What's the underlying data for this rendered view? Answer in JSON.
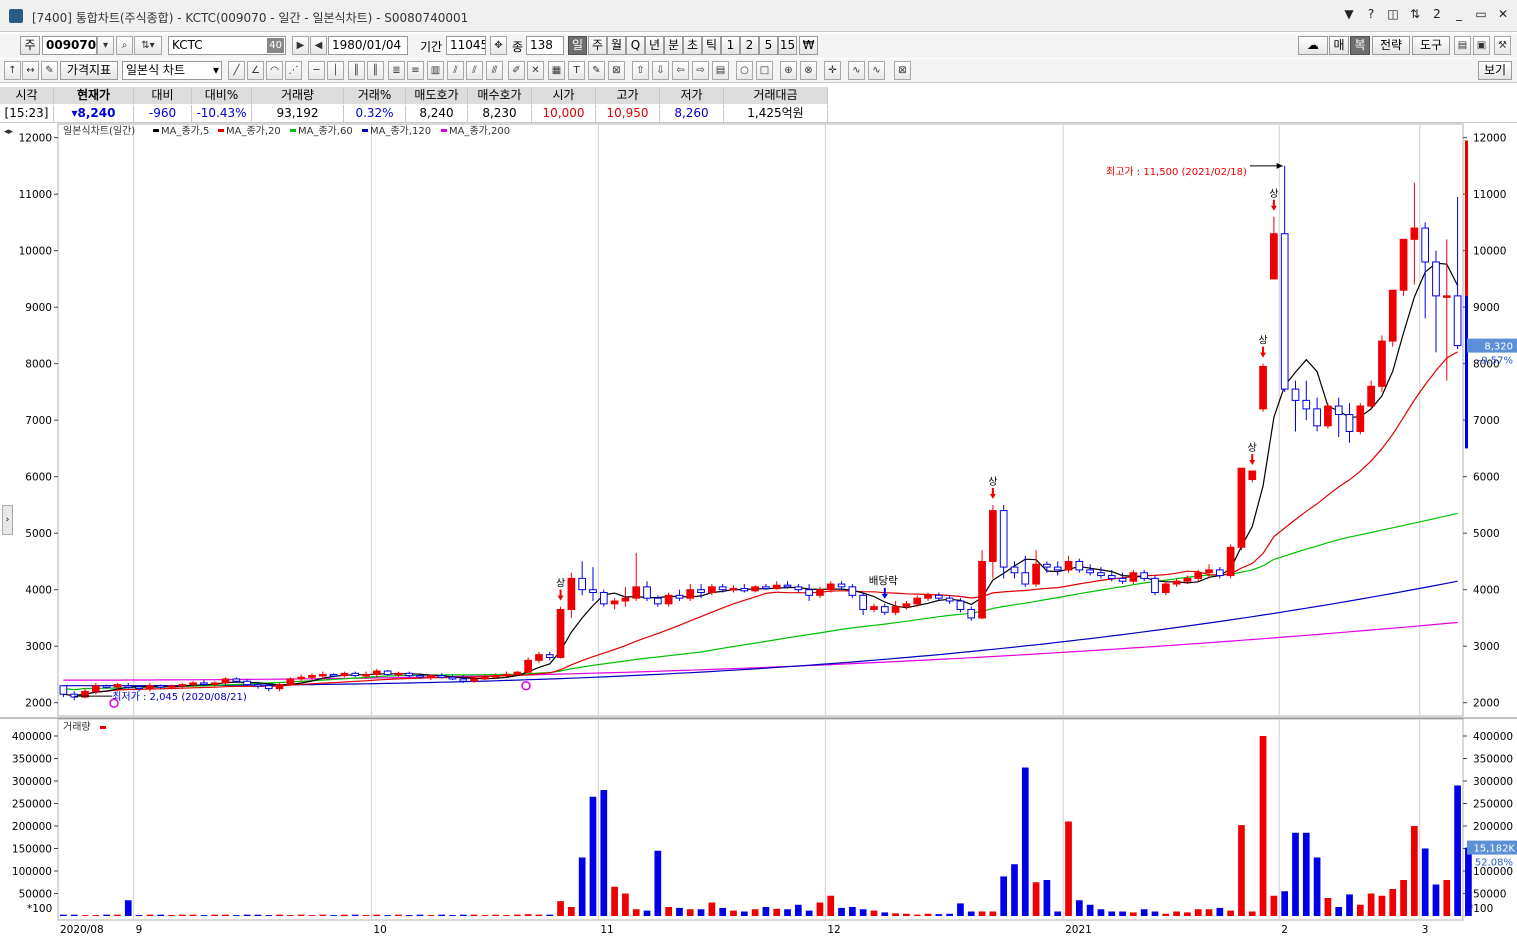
{
  "window": {
    "title": "[7400] 통합차트(주식종합) - KCTC(009070 - 일간 - 일본식차트) - S0080740001",
    "controls": [
      "▼",
      "?",
      "◫",
      "⇅",
      "2",
      "_",
      "▭",
      "✕"
    ]
  },
  "toolbar1": {
    "market_label": "주",
    "code": "009070",
    "name": "KCTC",
    "name_badge": "40",
    "date": "1980/01/04",
    "period_label": "기간",
    "period_value": "11045",
    "count_label": "종",
    "count_value": "138",
    "periods": [
      "일",
      "주",
      "월",
      "Q",
      "년",
      "분",
      "초",
      "틱",
      "1",
      "2",
      "5",
      "15",
      "₩"
    ],
    "selected_period": "일",
    "right_buttons": [
      "매",
      "복",
      "전략",
      "도구"
    ]
  },
  "toolbar2": {
    "indicator_label": "가격지표",
    "chart_type": "일본식 차트",
    "view_label": "보기"
  },
  "quote": {
    "headers": [
      "시각",
      "현재가",
      "대비",
      "대비%",
      "거래량",
      "거래%",
      "매도호가",
      "매수호가",
      "시가",
      "고가",
      "저가",
      "거래대금"
    ],
    "values": [
      "[15:23]",
      "▾8,240",
      "-960",
      "-10.43%",
      "93,192",
      "0.32%",
      "8,240",
      "8,230",
      "10,000",
      "10,950",
      "8,260",
      "1,425억원"
    ]
  },
  "price_panel": {
    "legend": {
      "title": "일본식차트(일간)",
      "ma": [
        {
          "label": "MA_종가,5",
          "color": "#000000"
        },
        {
          "label": "MA_종가,20",
          "color": "#e00000"
        },
        {
          "label": "MA_종가,60",
          "color": "#00c000"
        },
        {
          "label": "MA_종가,120",
          "color": "#0000c0"
        },
        {
          "label": "MA_종가,200",
          "color": "#e000e0"
        }
      ]
    },
    "high_note": "최고가 : 11,500 (2021/02/18)",
    "low_note": "최저가 : 2,045 (2020/08/21)",
    "dividend_note": "배당락",
    "limit_up_label": "상",
    "current_price_label": "8,320",
    "current_change_label": "-9.57%"
  },
  "volume_panel": {
    "legend": "거래량",
    "unit": "*100",
    "current_label": "15,182K",
    "current_pct": "52.08%"
  },
  "colors": {
    "up": "#ee0000",
    "down": "#0000e8",
    "ma5": "#000000",
    "ma20": "#e00000",
    "ma60": "#00c000",
    "ma120": "#0000c0",
    "ma200": "#e000e0",
    "grid": "#d0d0d0"
  },
  "chart_data": [
    {
      "type": "candlestick",
      "title": "일본식차트(일간)",
      "ylim": [
        1800,
        12100
      ],
      "y_ticks": [
        2000,
        3000,
        4000,
        5000,
        6000,
        7000,
        8000,
        9000,
        10000,
        11000,
        12000
      ],
      "x_labels": [
        "2020/08",
        "9",
        "10",
        "11",
        "12",
        "2021",
        "2",
        "3"
      ],
      "high": {
        "value": 11500,
        "date": "2021/02/18"
      },
      "low": {
        "value": 2045,
        "date": "2020/08/21"
      },
      "candles": [
        [
          2300,
          2300,
          2100,
          2150
        ],
        [
          2150,
          2200,
          2045,
          2100
        ],
        [
          2100,
          2250,
          2080,
          2200
        ],
        [
          2200,
          2350,
          2150,
          2300
        ],
        [
          2300,
          2320,
          2250,
          2280
        ],
        [
          2280,
          2350,
          2200,
          2320
        ],
        [
          2300,
          2350,
          2250,
          2280
        ],
        [
          2280,
          2300,
          2200,
          2250
        ],
        [
          2250,
          2350,
          2200,
          2300
        ],
        [
          2300,
          2320,
          2250,
          2280
        ],
        [
          2280,
          2320,
          2250,
          2300
        ],
        [
          2300,
          2350,
          2250,
          2320
        ],
        [
          2320,
          2380,
          2280,
          2350
        ],
        [
          2350,
          2400,
          2300,
          2330
        ],
        [
          2330,
          2380,
          2280,
          2350
        ],
        [
          2350,
          2450,
          2300,
          2420
        ],
        [
          2420,
          2450,
          2350,
          2380
        ],
        [
          2380,
          2420,
          2300,
          2320
        ],
        [
          2320,
          2350,
          2250,
          2300
        ],
        [
          2300,
          2320,
          2200,
          2250
        ],
        [
          2250,
          2350,
          2200,
          2320
        ],
        [
          2320,
          2450,
          2300,
          2420
        ],
        [
          2420,
          2500,
          2380,
          2450
        ],
        [
          2450,
          2520,
          2400,
          2480
        ],
        [
          2480,
          2550,
          2420,
          2500
        ],
        [
          2500,
          2520,
          2450,
          2480
        ],
        [
          2480,
          2550,
          2450,
          2520
        ],
        [
          2520,
          2550,
          2450,
          2480
        ],
        [
          2480,
          2550,
          2420,
          2500
        ],
        [
          2500,
          2600,
          2450,
          2560
        ],
        [
          2560,
          2580,
          2480,
          2500
        ],
        [
          2500,
          2550,
          2450,
          2520
        ],
        [
          2520,
          2550,
          2450,
          2480
        ],
        [
          2480,
          2520,
          2420,
          2460
        ],
        [
          2460,
          2500,
          2400,
          2480
        ],
        [
          2480,
          2520,
          2430,
          2450
        ],
        [
          2450,
          2500,
          2400,
          2420
        ],
        [
          2420,
          2480,
          2350,
          2380
        ],
        [
          2380,
          2450,
          2350,
          2420
        ],
        [
          2420,
          2500,
          2400,
          2460
        ],
        [
          2460,
          2520,
          2420,
          2480
        ],
        [
          2480,
          2550,
          2450,
          2500
        ],
        [
          2500,
          2560,
          2480,
          2540
        ],
        [
          2540,
          2800,
          2520,
          2750
        ],
        [
          2750,
          2900,
          2700,
          2850
        ],
        [
          2850,
          2900,
          2750,
          2800
        ],
        [
          2800,
          3700,
          2780,
          3650
        ],
        [
          3650,
          4300,
          3500,
          4200
        ],
        [
          4200,
          4500,
          3900,
          4000
        ],
        [
          4000,
          4400,
          3800,
          3950
        ],
        [
          3950,
          4000,
          3700,
          3750
        ],
        [
          3750,
          3850,
          3650,
          3800
        ],
        [
          3800,
          4050,
          3700,
          3850
        ],
        [
          3850,
          4650,
          3800,
          4050
        ],
        [
          4050,
          4150,
          3800,
          3850
        ],
        [
          3850,
          3900,
          3700,
          3750
        ],
        [
          3750,
          3950,
          3700,
          3900
        ],
        [
          3900,
          4000,
          3800,
          3850
        ],
        [
          3850,
          4100,
          3800,
          4000
        ],
        [
          4000,
          4100,
          3850,
          3950
        ],
        [
          3950,
          4100,
          3900,
          4050
        ],
        [
          4050,
          4100,
          3950,
          4000
        ],
        [
          4000,
          4080,
          3950,
          4020
        ],
        [
          4020,
          4100,
          3950,
          3980
        ],
        [
          3980,
          4080,
          3950,
          4050
        ],
        [
          4050,
          4100,
          4000,
          4020
        ],
        [
          4020,
          4150,
          4000,
          4080
        ],
        [
          4080,
          4150,
          4020,
          4050
        ],
        [
          4050,
          4100,
          3950,
          4000
        ],
        [
          4000,
          4100,
          3800,
          3900
        ],
        [
          3900,
          4050,
          3850,
          4000
        ],
        [
          4000,
          4150,
          3950,
          4100
        ],
        [
          4100,
          4150,
          4000,
          4050
        ],
        [
          4050,
          4100,
          3850,
          3900
        ],
        [
          3900,
          3950,
          3550,
          3650
        ],
        [
          3650,
          3750,
          3600,
          3700
        ],
        [
          3700,
          3750,
          3550,
          3600
        ],
        [
          3600,
          3800,
          3550,
          3700
        ],
        [
          3700,
          3800,
          3650,
          3750
        ],
        [
          3750,
          3900,
          3700,
          3850
        ],
        [
          3850,
          3950,
          3800,
          3900
        ],
        [
          3900,
          3950,
          3800,
          3850
        ],
        [
          3850,
          3900,
          3750,
          3800
        ],
        [
          3800,
          3850,
          3600,
          3650
        ],
        [
          3650,
          3700,
          3450,
          3500
        ],
        [
          3500,
          4700,
          3480,
          4500
        ],
        [
          4500,
          5500,
          4200,
          5400
        ],
        [
          5400,
          5500,
          4200,
          4400
        ],
        [
          4400,
          4500,
          4200,
          4300
        ],
        [
          4300,
          4600,
          4050,
          4100
        ],
        [
          4100,
          4700,
          4050,
          4450
        ],
        [
          4450,
          4500,
          4300,
          4400
        ],
        [
          4400,
          4500,
          4250,
          4350
        ],
        [
          4350,
          4600,
          4300,
          4500
        ],
        [
          4500,
          4550,
          4300,
          4350
        ],
        [
          4350,
          4450,
          4250,
          4300
        ],
        [
          4300,
          4400,
          4200,
          4250
        ],
        [
          4250,
          4350,
          4150,
          4200
        ],
        [
          4200,
          4300,
          4100,
          4150
        ],
        [
          4150,
          4350,
          4100,
          4300
        ],
        [
          4300,
          4350,
          4150,
          4200
        ],
        [
          4200,
          4250,
          3900,
          3950
        ],
        [
          3950,
          4150,
          3900,
          4100
        ],
        [
          4100,
          4200,
          4050,
          4150
        ],
        [
          4150,
          4250,
          4100,
          4200
        ],
        [
          4200,
          4350,
          4150,
          4300
        ],
        [
          4300,
          4450,
          4200,
          4350
        ],
        [
          4350,
          4400,
          4200,
          4250
        ],
        [
          4250,
          4800,
          4200,
          4750
        ],
        [
          4750,
          6100,
          4700,
          6150
        ],
        [
          5950,
          6100,
          5900,
          6100
        ],
        [
          7200,
          8000,
          7150,
          7950
        ],
        [
          9500,
          10600,
          9500,
          10300
        ],
        [
          10300,
          11500,
          7500,
          7550
        ],
        [
          7550,
          7700,
          6800,
          7350
        ],
        [
          7350,
          7700,
          7000,
          7200
        ],
        [
          7200,
          7400,
          6800,
          6900
        ],
        [
          6900,
          7300,
          6850,
          7250
        ],
        [
          7250,
          7400,
          6700,
          7100
        ],
        [
          7100,
          7300,
          6600,
          6800
        ],
        [
          6800,
          7300,
          6750,
          7250
        ],
        [
          7250,
          7700,
          7200,
          7600
        ],
        [
          7600,
          8500,
          7500,
          8400
        ],
        [
          8400,
          9200,
          8300,
          9300
        ],
        [
          9300,
          10200,
          9200,
          10200
        ],
        [
          10200,
          11200,
          9400,
          10400
        ],
        [
          10400,
          10500,
          8800,
          9800
        ],
        [
          9800,
          10000,
          8200,
          9200
        ],
        [
          9200,
          10200,
          7700,
          9200
        ],
        [
          9200,
          10950,
          8260,
          8320
        ]
      ],
      "ma_end_values": {
        "ma5": 8900,
        "ma20": 7900,
        "ma60": 5350,
        "ma120": 4150,
        "ma200": 3420
      }
    },
    {
      "type": "bar",
      "title": "거래량",
      "unit": "*100",
      "ylim": [
        0,
        420000
      ],
      "y_ticks": [
        50000,
        100000,
        150000,
        200000,
        250000,
        300000,
        350000,
        400000
      ],
      "values": [
        3000,
        3000,
        2000,
        2000,
        3000,
        3000,
        35000,
        2000,
        3000,
        3000,
        2000,
        3000,
        3000,
        2000,
        3000,
        3000,
        2000,
        3000,
        3000,
        2000,
        3000,
        2000,
        3000,
        2000,
        3000,
        2000,
        3000,
        3000,
        2000,
        3000,
        2000,
        3000,
        2000,
        3000,
        2000,
        3000,
        2000,
        3000,
        3000,
        2000,
        3000,
        2000,
        3000,
        4000,
        3000,
        3000,
        33000,
        20000,
        130000,
        265000,
        280000,
        65000,
        50000,
        15000,
        12000,
        145000,
        20000,
        18000,
        15000,
        15000,
        30000,
        18000,
        12000,
        10000,
        15000,
        20000,
        16000,
        15000,
        25000,
        12000,
        30000,
        45000,
        18000,
        20000,
        15000,
        12000,
        8000,
        6000,
        5000,
        3000,
        5000,
        4000,
        5000,
        28000,
        10000,
        10000,
        10000,
        88000,
        115000,
        330000,
        75000,
        80000,
        10000,
        210000,
        35000,
        25000,
        15000,
        10000,
        10000,
        8000,
        15000,
        10000,
        5000,
        10000,
        8000,
        15000,
        15000,
        18000,
        12000,
        202000,
        10000,
        400000,
        45000,
        55000,
        185000,
        185000,
        130000,
        40000,
        20000,
        48000,
        25000,
        50000,
        45000,
        60000,
        80000,
        200000,
        150000,
        70000,
        80000,
        290000,
        152000
      ]
    }
  ]
}
